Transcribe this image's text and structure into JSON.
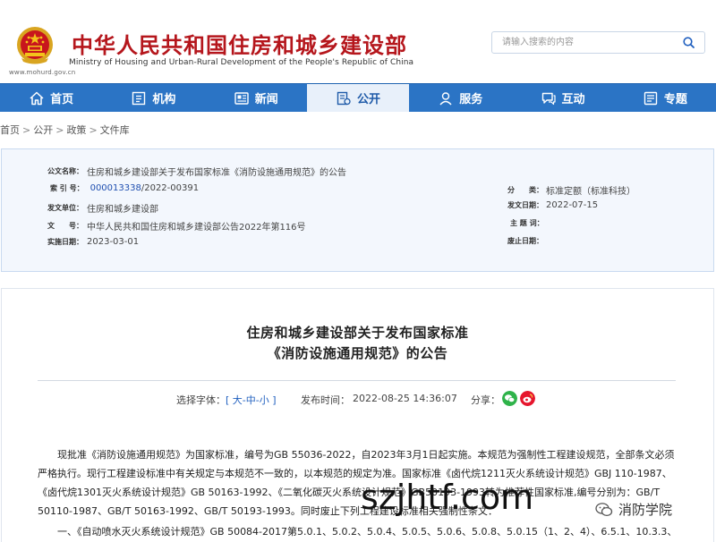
{
  "header": {
    "site_title": "中华人民共和国住房和城乡建设部",
    "site_subtitle": "Ministry of Housing and Urban-Rural Development of the People's Republic of China",
    "site_url": "www.mohurd.gov.cn",
    "search_placeholder": "请输入搜索的内容"
  },
  "nav": {
    "items": [
      {
        "label": "首页",
        "icon": "home-icon"
      },
      {
        "label": "机构",
        "icon": "org-icon"
      },
      {
        "label": "新闻",
        "icon": "news-icon"
      },
      {
        "label": "公开",
        "icon": "public-icon",
        "active": true
      },
      {
        "label": "服务",
        "icon": "service-icon"
      },
      {
        "label": "互动",
        "icon": "interact-icon"
      },
      {
        "label": "专题",
        "icon": "topic-icon"
      }
    ]
  },
  "breadcrumb": [
    "首页",
    "公开",
    "政策",
    "文件库"
  ],
  "meta": {
    "doc_name_label": "公文名称：",
    "doc_name": "住房和城乡建设部关于发布国家标准《消防设施通用规范》的公告",
    "index_label": "索 引 号：",
    "index_blue": "000013338",
    "index_rest": "/2022-00391",
    "issuer_label": "发文单位：",
    "issuer": "住房和城乡建设部",
    "docno_label": "文　　号：",
    "docno": "中华人民共和国住房和城乡建设部公告2022年第116号",
    "impl_label": "实施日期：",
    "impl_date": "2023-03-01",
    "category_label": "分　　类：",
    "category": "标准定额（标准科技）",
    "issue_date_label": "发文日期：",
    "issue_date": "2022-07-15",
    "topic_label": "主 题 词：",
    "topic": "",
    "abolish_label": "废止日期：",
    "abolish": ""
  },
  "article": {
    "title_line1": "住房和城乡建设部关于发布国家标准",
    "title_line2": "《消防设施通用规范》的公告",
    "font_label": "选择字体：",
    "font_open": "[ ",
    "font_large": "大",
    "font_sep1": "-",
    "font_mid": "中",
    "font_sep2": "-",
    "font_small": "小",
    "font_close": " ]",
    "pub_label": "发布时间：",
    "pub_time": "2022-08-25 14:36:07",
    "share_label": "分享：",
    "para1": "现批准《消防设施通用规范》为国家标准，编号为GB 55036-2022，自2023年3月1日起实施。本规范为强制性工程建设规范，全部条文必须严格执行。现行工程建设标准中有关规定与本规范不一致的，以本规范的规定为准。国家标准《卤代烷1211灭火系统设计规范》GBJ 110-1987、《卤代烷1301灭火系统设计规范》GB 50163-1992、《二氧化碳灭火系统设计规范》GB50193-1993转为推荐性国家标准,编号分别为：GB/T 50110-1987、GB/T 50163-1992、GB/T 50193-1993。同时废止下列工程建设标准相关强制性条文：",
    "para2": "一、《自动喷水灭火系统设计规范》GB 50084-2017第5.0.1、5.0.2、5.0.4、5.0.5、5.0.6、5.0.8、5.0.15（1、2、4）、6.5.1、10.3.3、"
  },
  "watermark": {
    "big": "szjhtf.com",
    "corner": "消防学院"
  },
  "colors": {
    "brand_red": "#b5161c",
    "nav_blue": "#2b74c5",
    "link_blue": "#1f5fbf"
  }
}
